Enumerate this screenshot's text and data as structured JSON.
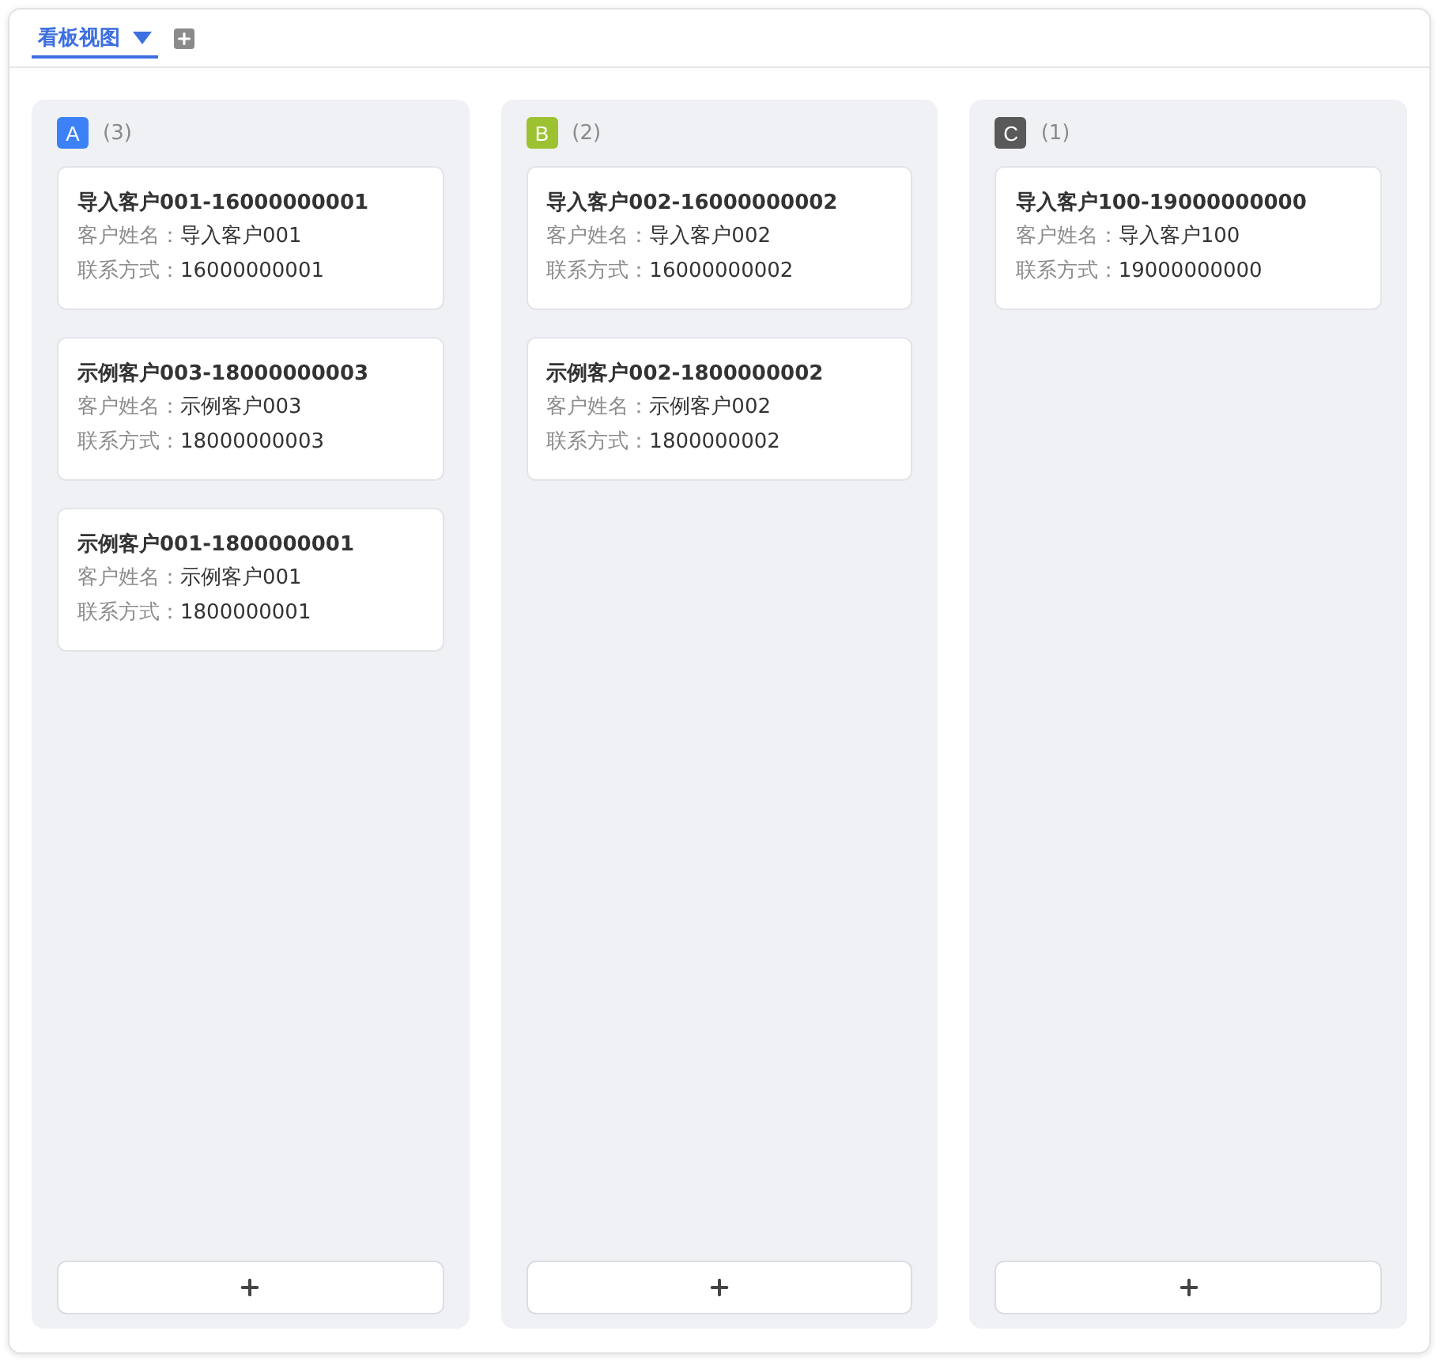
{
  "tabs": [
    {
      "label": "看板视图",
      "selected": true
    }
  ],
  "columns": [
    {
      "key": "A",
      "color": "#3c82f6",
      "count": "(3)",
      "cards": [
        {
          "title": "导入客户001-16000000001",
          "fields": [
            {
              "label": "客户姓名：",
              "value": "导入客户001"
            },
            {
              "label": "联系方式：",
              "value": "16000000001"
            }
          ]
        },
        {
          "title": "示例客户003-18000000003",
          "fields": [
            {
              "label": "客户姓名：",
              "value": "示例客户003"
            },
            {
              "label": "联系方式：",
              "value": "18000000003"
            }
          ]
        },
        {
          "title": "示例客户001-1800000001",
          "fields": [
            {
              "label": "客户姓名：",
              "value": "示例客户001"
            },
            {
              "label": "联系方式：",
              "value": "1800000001"
            }
          ]
        }
      ]
    },
    {
      "key": "B",
      "color": "#9cc232",
      "count": "(2)",
      "cards": [
        {
          "title": "导入客户002-16000000002",
          "fields": [
            {
              "label": "客户姓名：",
              "value": "导入客户002"
            },
            {
              "label": "联系方式：",
              "value": "16000000002"
            }
          ]
        },
        {
          "title": "示例客户002-1800000002",
          "fields": [
            {
              "label": "客户姓名：",
              "value": "示例客户002"
            },
            {
              "label": "联系方式：",
              "value": "1800000002"
            }
          ]
        }
      ]
    },
    {
      "key": "C",
      "color": "#595959",
      "count": "(1)",
      "cards": [
        {
          "title": "导入客户100-19000000000",
          "fields": [
            {
              "label": "客户姓名：",
              "value": "导入客户100"
            },
            {
              "label": "联系方式：",
              "value": "19000000000"
            }
          ]
        }
      ]
    }
  ]
}
